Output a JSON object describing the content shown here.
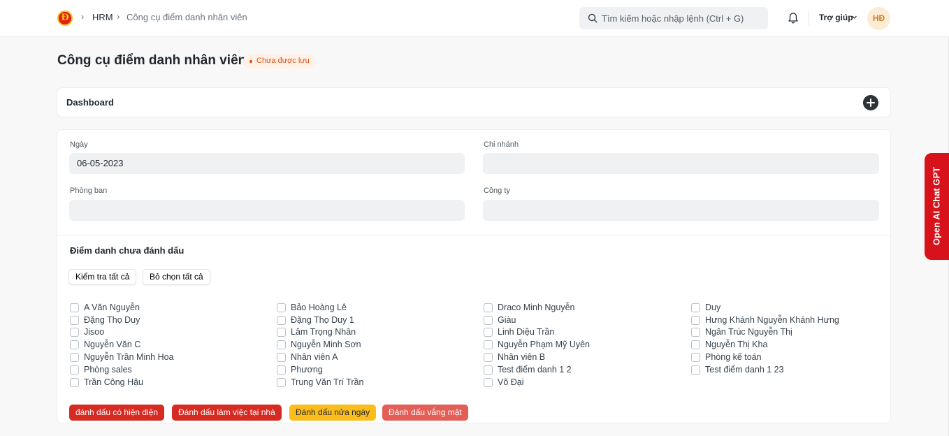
{
  "navbar": {
    "logo_letter": "Đ",
    "breadcrumbs": [
      "HRM",
      "Công cụ điểm danh nhân viên"
    ],
    "search_placeholder": "Tìm kiếm hoặc nhập lệnh (Ctrl + G)",
    "help_label": "Trợ giúp",
    "avatar_initials": "HĐ"
  },
  "page": {
    "title": "Công cụ điểm danh nhân viên",
    "status": "Chưa được lưu"
  },
  "dashboard": {
    "title": "Dashboard"
  },
  "form": {
    "date_label": "Ngày",
    "date_value": "06-05-2023",
    "branch_label": "Chi nhánh",
    "branch_value": "",
    "department_label": "Phòng ban",
    "department_value": "",
    "company_label": "Công ty",
    "company_value": ""
  },
  "unmarked": {
    "title": "Điểm danh chưa đánh dấu",
    "check_all": "Kiểm tra tất cả",
    "uncheck_all": "Bỏ chọn tất cả",
    "columns": [
      [
        "A Văn Nguyễn",
        "Đặng Thọ Duy",
        "Jisoo",
        "Nguyễn Văn C",
        "Nguyễn Trần Minh Hoa",
        "Phòng sales",
        "Trần Công Hậu"
      ],
      [
        "Bảo Hoàng Lê",
        "Đặng Thọ Duy 1",
        "Lâm Trọng Nhân",
        "Nguyễn Minh Sơn",
        "Nhân viên A",
        "Phương",
        "Trung Văn Trí Trần"
      ],
      [
        "Draco Minh Nguyễn",
        "Giàu",
        "Linh Diệu Trần",
        "Nguyễn Phạm Mỹ Uyên",
        "Nhân viên B",
        "Test điểm danh 1 2",
        "Võ Đại"
      ],
      [
        "Duy",
        "Hưng Khánh Nguyễn Khánh Hưng",
        "Ngân Trúc Nguyễn Thị",
        "Nguyễn Thị Kha",
        "Phòng kế toán",
        "Test điểm danh 1 23"
      ]
    ]
  },
  "actions": {
    "present": "đánh dấu có hiện diện",
    "wfh": "Đánh dấu làm việc tại nhà",
    "half_day": "Đánh dấu nửa ngày",
    "absent": "Đánh dấu vắng mặt"
  },
  "side_tab": {
    "label": "Open AI Chat GPT"
  },
  "colors": {
    "brand_red": "#d62b22",
    "half_day_yellow": "#fbbd1c",
    "absent_red": "#e35e56",
    "status_orange": "#e04e14"
  }
}
